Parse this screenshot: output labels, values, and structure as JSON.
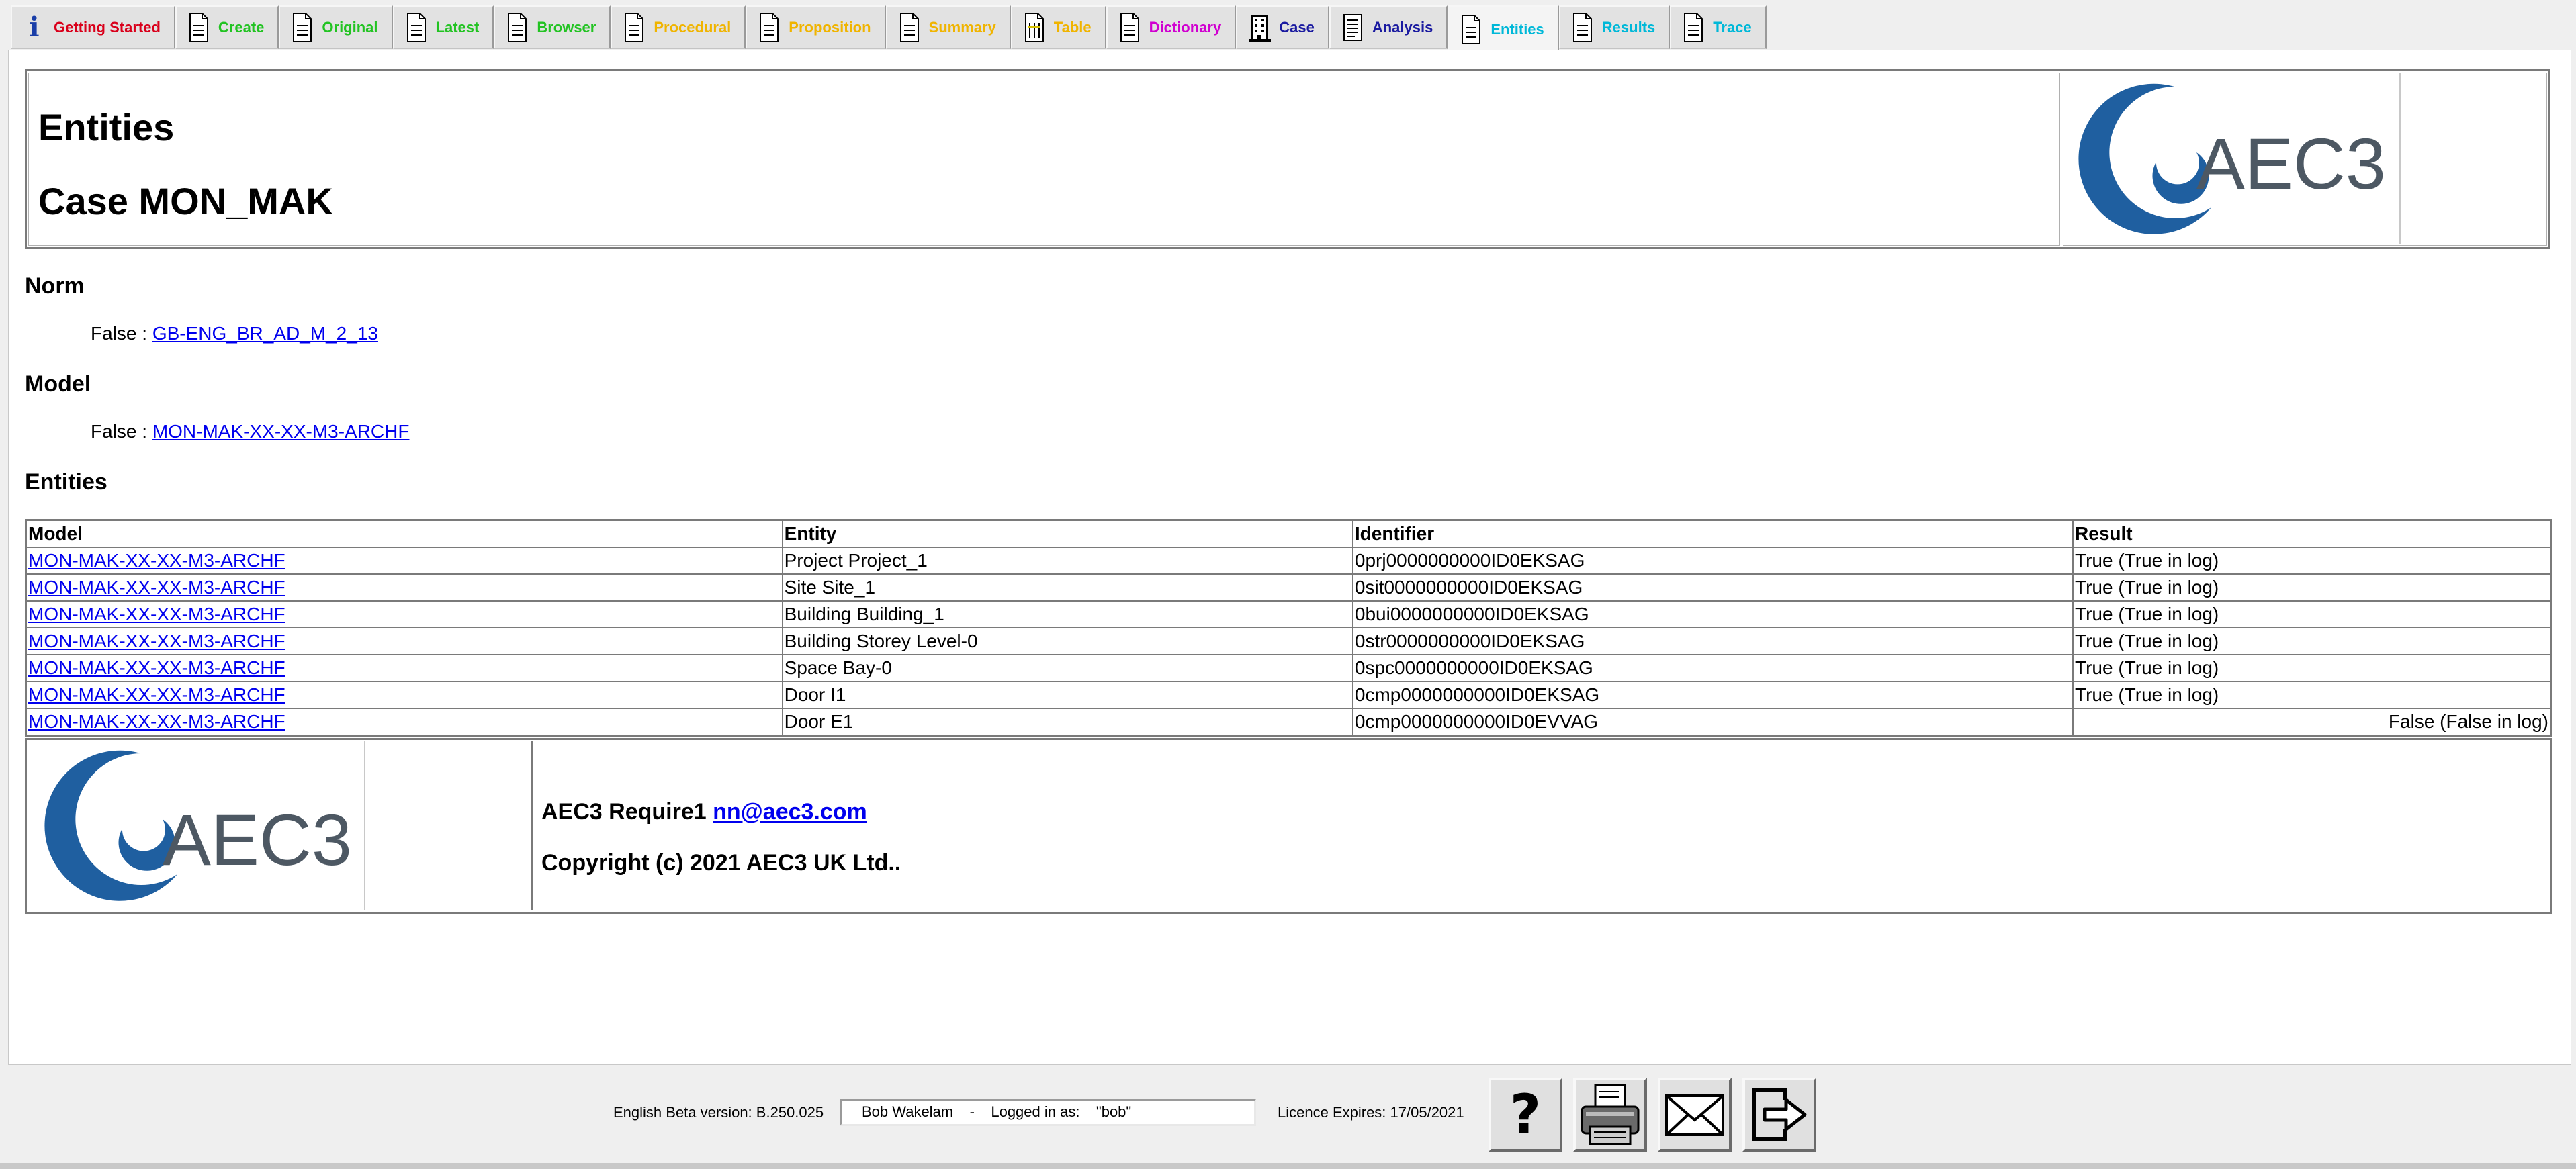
{
  "tabs": [
    {
      "label": "Getting Started",
      "color": "#d9001b",
      "icon": "info-icon"
    },
    {
      "label": "Create",
      "color": "#22c322",
      "icon": "document-icon"
    },
    {
      "label": "Original",
      "color": "#22c322",
      "icon": "document-icon"
    },
    {
      "label": "Latest",
      "color": "#22c322",
      "icon": "document-icon"
    },
    {
      "label": "Browser",
      "color": "#22c322",
      "icon": "document-icon"
    },
    {
      "label": "Procedural",
      "color": "#f0b400",
      "icon": "document-icon"
    },
    {
      "label": "Proposition",
      "color": "#f0b400",
      "icon": "document-icon"
    },
    {
      "label": "Summary",
      "color": "#f0b400",
      "icon": "document-icon"
    },
    {
      "label": "Table",
      "color": "#f0b400",
      "icon": "table-document-icon"
    },
    {
      "label": "Dictionary",
      "color": "#d000d0",
      "icon": "document-icon"
    },
    {
      "label": "Case",
      "color": "#1a1aa0",
      "icon": "building-icon"
    },
    {
      "label": "Analysis",
      "color": "#1a1aa0",
      "icon": "analysis-icon"
    },
    {
      "label": "Entities",
      "color": "#00b8d8",
      "icon": "document-icon",
      "active": true
    },
    {
      "label": "Results",
      "color": "#00b8d8",
      "icon": "document-icon"
    },
    {
      "label": "Trace",
      "color": "#00b8d8",
      "icon": "document-icon"
    }
  ],
  "header": {
    "title": "Entities",
    "case": "Case MON_MAK",
    "logo_text": "AEC3"
  },
  "norm": {
    "heading": "Norm",
    "prefix": "False : ",
    "link": "GB-ENG_BR_AD_M_2_13"
  },
  "model": {
    "heading": "Model",
    "prefix": "False : ",
    "link": "MON-MAK-XX-XX-M3-ARCHF"
  },
  "entities": {
    "heading": "Entities",
    "columns": [
      "Model",
      "Entity",
      "Identifier",
      "Result"
    ],
    "rows": [
      {
        "model": "MON-MAK-XX-XX-M3-ARCHF",
        "entity": "Project Project_1",
        "identifier": "0prj0000000000ID0EKSAG",
        "result": "True (True in log)"
      },
      {
        "model": "MON-MAK-XX-XX-M3-ARCHF",
        "entity": "Site Site_1",
        "identifier": "0sit0000000000ID0EKSAG",
        "result": "True (True in log)"
      },
      {
        "model": "MON-MAK-XX-XX-M3-ARCHF",
        "entity": "Building Building_1",
        "identifier": "0bui0000000000ID0EKSAG",
        "result": "True (True in log)"
      },
      {
        "model": "MON-MAK-XX-XX-M3-ARCHF",
        "entity": "Building Storey Level-0",
        "identifier": "0str0000000000ID0EKSAG",
        "result": "True (True in log)"
      },
      {
        "model": "MON-MAK-XX-XX-M3-ARCHF",
        "entity": "Space Bay-0",
        "identifier": "0spc0000000000ID0EKSAG",
        "result": "True (True in log)"
      },
      {
        "model": "MON-MAK-XX-XX-M3-ARCHF",
        "entity": "Door I1",
        "identifier": "0cmp0000000000ID0EKSAG",
        "result": "True (True in log)"
      },
      {
        "model": "MON-MAK-XX-XX-M3-ARCHF",
        "entity": "Door E1",
        "identifier": "0cmp0000000000ID0EVVAG",
        "result": "False (False in log)"
      }
    ]
  },
  "footer": {
    "product": "AEC3 Require1",
    "email": "nn@aec3.com",
    "copyright": "Copyright (c) 2021 AEC3 UK Ltd.."
  },
  "status": {
    "version": "English Beta version: B.250.025",
    "login": "Bob Wakelam    -    Logged in as:    \"bob\"",
    "licence": "Licence Expires: 17/05/2021"
  },
  "toolbar": {
    "help": "?",
    "buttons": [
      "help-icon",
      "print-icon",
      "mail-icon",
      "logout-icon"
    ]
  },
  "colors": {
    "link": "#0000ee",
    "logo_blue": "#1f5fa0",
    "logo_grey": "#4d5863"
  }
}
